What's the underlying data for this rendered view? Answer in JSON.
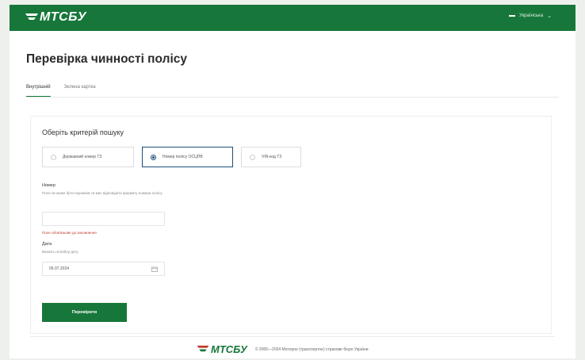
{
  "header": {
    "logo_text": "МТСБУ",
    "language_label": "Українська"
  },
  "page": {
    "title": "Перевірка чинності полісу"
  },
  "tabs": [
    {
      "label": "Внутрішній"
    },
    {
      "label": "Зелена картка"
    }
  ],
  "form": {
    "section_title": "Оберіть критерій пошуку",
    "options": [
      {
        "label": "Державний номер ТЗ",
        "selected": false
      },
      {
        "label": "Номер полісу ОСЦПВ",
        "selected": true
      },
      {
        "label": "VIN-код ТЗ",
        "selected": false
      }
    ],
    "number_label": "Номер",
    "number_hint": "Поле не може бути порожнім та має відповідати формату номера полісу",
    "number_value": "",
    "error_text": "Поле обов'язкове до заповнення",
    "date_label": "Дата",
    "date_hint": "Вкажіть потрібну дату",
    "date_value": "05.07.2024",
    "submit_label": "Перевірити"
  },
  "footer": {
    "logo_text": "МТСБУ",
    "copyright": "© 2005—2024 Моторне (транспортне) страхове бюро України"
  },
  "colors": {
    "brand_green": "#17773a",
    "selected_border": "#1c4f7a",
    "error": "#c0392b"
  }
}
